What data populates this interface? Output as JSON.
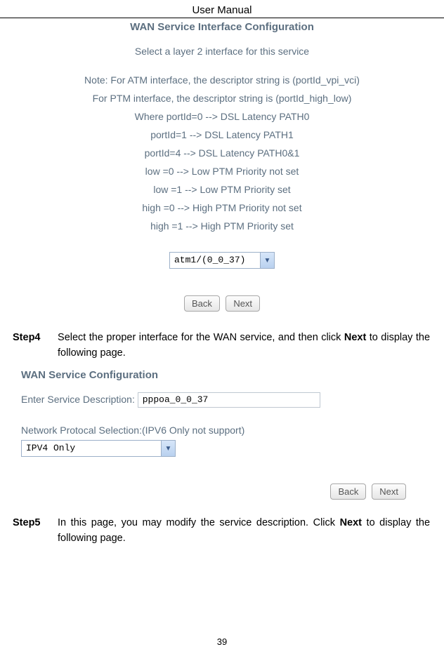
{
  "header": "User Manual",
  "fig1": {
    "title": "WAN Service Interface Configuration",
    "subtitle": "Select a layer 2 interface for this service",
    "notes": [
      "Note: For ATM interface, the descriptor string is (portId_vpi_vci)",
      "For PTM interface, the descriptor string is (portId_high_low)",
      "Where portId=0 --> DSL Latency PATH0",
      "portId=1 --> DSL Latency PATH1",
      "portId=4 --> DSL Latency PATH0&1",
      "low =0 --> Low PTM Priority not set",
      "low =1 --> Low PTM Priority set",
      "high =0 --> High PTM Priority not set",
      "high =1 --> High PTM Priority set"
    ],
    "select_value": "atm1/(0_0_37)",
    "back": "Back",
    "next": "Next"
  },
  "step4": {
    "label": "Step4",
    "text_pre": "Select the proper interface for the WAN service, and then click ",
    "bold": "Next",
    "text_post": " to display the following page."
  },
  "fig2": {
    "title": "WAN Service Configuration",
    "desc_label": "Enter Service Description:",
    "desc_value": "pppoa_0_0_37",
    "proto_label": "Network Protocal Selection:(IPV6 Only not support)",
    "proto_value": "IPV4 Only",
    "back": "Back",
    "next": "Next"
  },
  "step5": {
    "label": "Step5",
    "text_pre": "In this page, you may modify the service description. Click ",
    "bold": "Next",
    "text_post": " to display the following page."
  },
  "page_number": "39"
}
